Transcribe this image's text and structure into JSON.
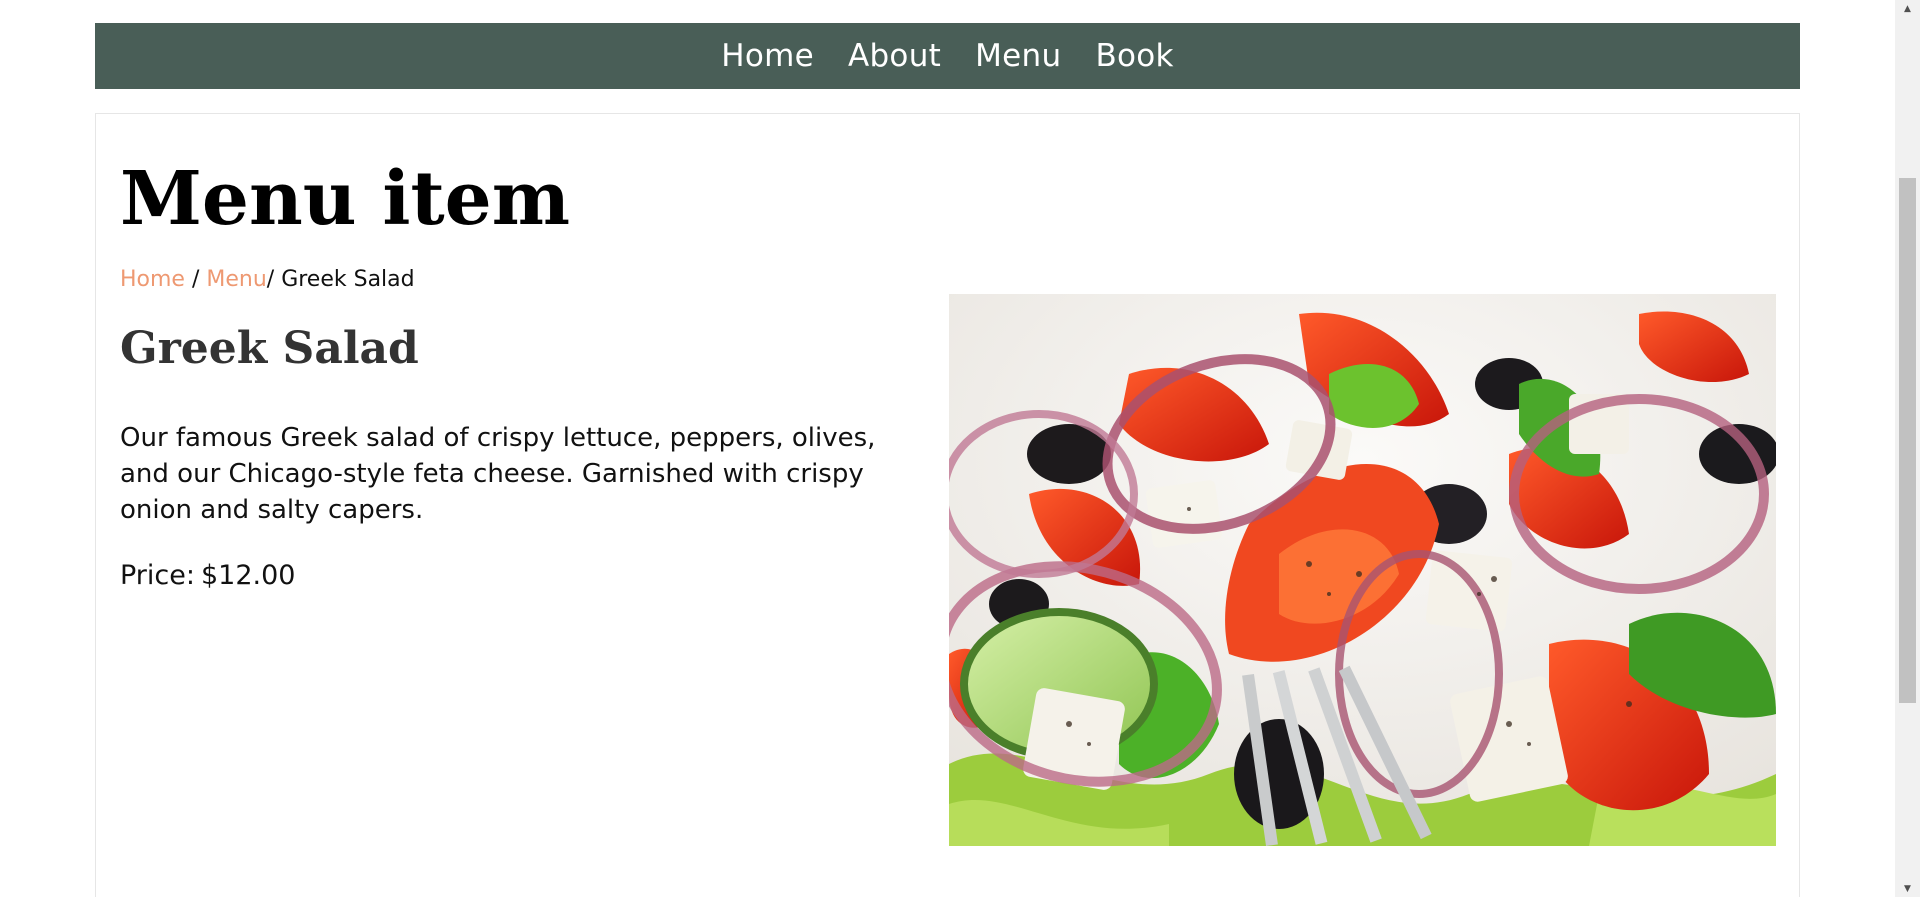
{
  "nav": {
    "items": [
      {
        "label": "Home"
      },
      {
        "label": "About"
      },
      {
        "label": "Menu"
      },
      {
        "label": "Book"
      }
    ]
  },
  "page": {
    "title": "Menu item"
  },
  "breadcrumb": {
    "home": "Home",
    "sep1": " / ",
    "menu": "Menu",
    "sep2": "/ ",
    "current": "Greek Salad"
  },
  "item": {
    "name": "Greek Salad",
    "description": "Our famous Greek salad of crispy lettuce, peppers, olives, and our Chicago-style feta cheese. Garnished with crispy onion and salty capers.",
    "price_label": "Price:",
    "price": "$12.00",
    "image": "salad-photo"
  },
  "colors": {
    "nav_bg": "#495e57",
    "link_accent": "#ee9972",
    "heading_dark": "#333333"
  },
  "icons": {
    "scroll_up": "▲",
    "scroll_down": "▼"
  }
}
